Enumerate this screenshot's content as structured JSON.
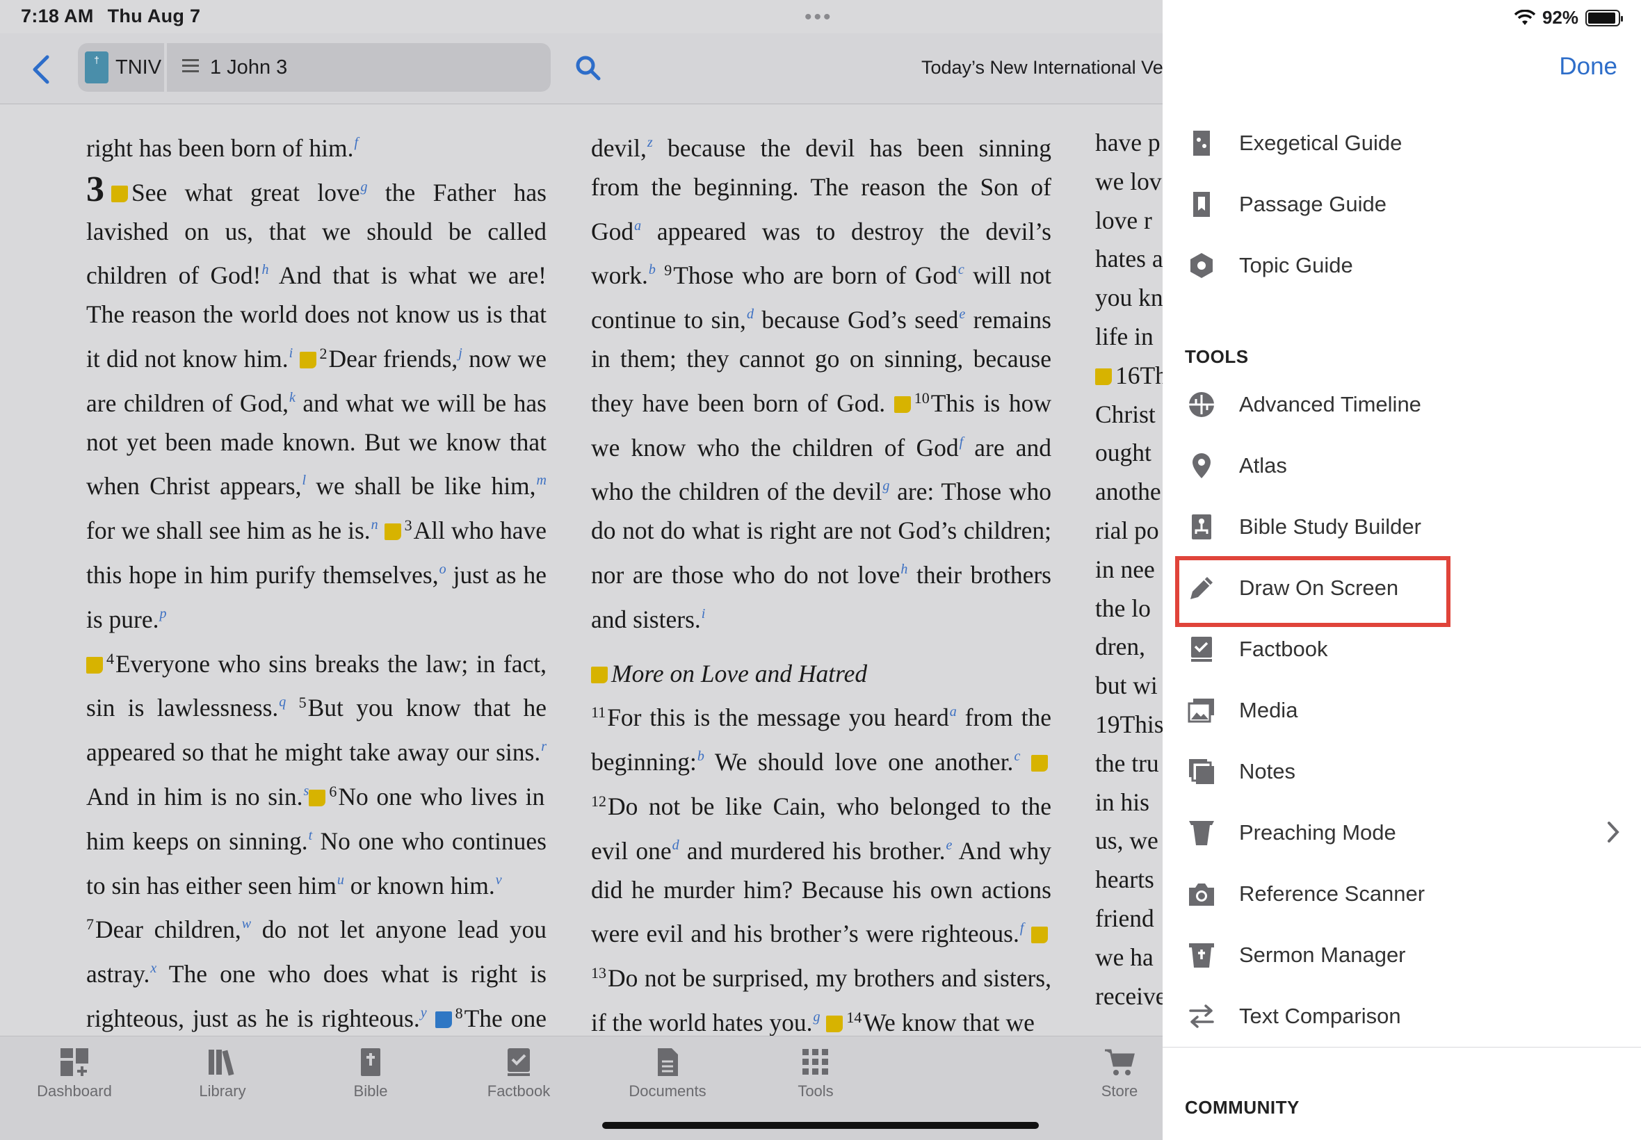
{
  "status": {
    "time": "7:18 AM",
    "date": "Thu Aug 7",
    "battery": "92%"
  },
  "toolbar": {
    "version_abbr": "TNIV",
    "reference": "1 John 3",
    "version_title": "Today’s New International Version"
  },
  "bible": {
    "col1": {
      "s1": "right has been born of him.",
      "chapter": "3",
      "t1": "See what great love",
      "t2": " the Father has lavished on us, that we should be called children of God!",
      "t3": " And that is what we are! The reason the world does not know us is that it did not know him.",
      "v2": "2",
      "t4": "Dear friends,",
      "t5": " now we are children of God,",
      "t6": " and what we will be has not yet been made known. But we know that when Christ appears,",
      "t7": " we shall be like him,",
      "t8": " for we shall see him as he is.",
      "v3": "3",
      "t9": "All who have this hope in him purify themselves,",
      "t10": " just as he is pure.",
      "v4": "4",
      "t11": "Everyone who sins breaks the law; in fact, sin is lawlessness.",
      "v5": "5",
      "t12": "But you know that he appeared so that he might take away our sins.",
      "t13": " And in him is no sin.",
      "v6": "6",
      "t14": "No one who lives in him keeps on sinning.",
      "t15": " No one who continues to sin has either seen him",
      "t16": " or known him.",
      "v7": "7",
      "t17": "Dear children,",
      "t18": " do not let anyone lead you astray.",
      "t19": " The one who does what is right is righteous, just as he is righteous.",
      "v8": "8",
      "t20": "The one who does what is sinful is of the"
    },
    "col2": {
      "t1": "devil,",
      "t2": " because the devil has been sinning from the beginning. The reason the Son of God",
      "t3": " appeared was to destroy the devil’s work.",
      "v9": "9",
      "t4": "Those who are born of God",
      "t5": " will not continue to sin,",
      "t6": " because God’s seed",
      "t7": " remains in them; they cannot go on sinning, because they have been born of God.",
      "v10": "10",
      "t8": "This is how we know who the children of God",
      "t9": " are and who the children of the devil",
      "t10": " are: Those who do not do what is right are not God’s children; nor are those who do not love",
      "t11": " their brothers and sisters.",
      "heading": "More on Love and Hatred",
      "v11": "11",
      "t12": "For this is the message you heard",
      "t13": " from the beginning:",
      "t14": " We should love one another.",
      "v12": "12",
      "t15": "Do not be like Cain, who belonged to the evil one",
      "t16": " and murdered his brother.",
      "t17": " And why did he murder him? Because his own actions were evil and his brother’s were righteous.",
      "v13": "13",
      "t18": "Do not be surprised, my brothers and sisters, if the world hates you.",
      "v14": "14",
      "t19": "We know that we"
    },
    "col3": [
      "have p",
      "we lov",
      "love r",
      "hates a",
      "you kn",
      "life in",
      "16Th",
      "Christ",
      "ought",
      "anothe",
      "rial po",
      "in nee",
      "the lo",
      "dren,",
      "but wi",
      "19This",
      "the tru",
      "in his",
      "us, we",
      "hearts",
      "friend",
      "we ha",
      "receive"
    ],
    "footnotes": [
      "f",
      "g",
      "h",
      "i",
      "j",
      "k",
      "l",
      "m",
      "n",
      "o",
      "p",
      "q",
      "r",
      "s",
      "t",
      "u",
      "v",
      "w",
      "x",
      "y",
      "z",
      "a",
      "b",
      "c",
      "d",
      "e",
      "f",
      "g",
      "h",
      "i",
      "a",
      "b",
      "c",
      "d",
      "e",
      "f",
      "g"
    ]
  },
  "tabbar": {
    "items": [
      {
        "label": "Dashboard",
        "icon": "dashboard-icon"
      },
      {
        "label": "Library",
        "icon": "library-icon"
      },
      {
        "label": "Bible",
        "icon": "bible-icon"
      },
      {
        "label": "Factbook",
        "icon": "factbook-icon"
      },
      {
        "label": "Documents",
        "icon": "documents-icon"
      },
      {
        "label": "Tools",
        "icon": "tools-grid-icon"
      },
      {
        "label": "Store",
        "icon": "cart-icon"
      }
    ]
  },
  "panel": {
    "done_label": "Done",
    "guides": [
      {
        "label": "Exegetical Guide",
        "icon": "exegetical-guide-icon"
      },
      {
        "label": "Passage Guide",
        "icon": "passage-guide-icon"
      },
      {
        "label": "Topic Guide",
        "icon": "topic-guide-icon"
      }
    ],
    "tools_header": "TOOLS",
    "tools": [
      {
        "label": "Advanced Timeline",
        "icon": "timeline-icon"
      },
      {
        "label": "Atlas",
        "icon": "map-pin-icon"
      },
      {
        "label": "Bible Study Builder",
        "icon": "study-builder-icon"
      },
      {
        "label": "Draw On Screen",
        "icon": "pencil-icon"
      },
      {
        "label": "Factbook",
        "icon": "factbook-icon"
      },
      {
        "label": "Media",
        "icon": "media-icon"
      },
      {
        "label": "Notes",
        "icon": "notes-icon"
      },
      {
        "label": "Preaching Mode",
        "icon": "pulpit-icon"
      },
      {
        "label": "Reference Scanner",
        "icon": "camera-icon"
      },
      {
        "label": "Sermon Manager",
        "icon": "sermon-icon"
      },
      {
        "label": "Text Comparison",
        "icon": "compare-arrows-icon"
      }
    ],
    "community_header": "COMMUNITY"
  }
}
